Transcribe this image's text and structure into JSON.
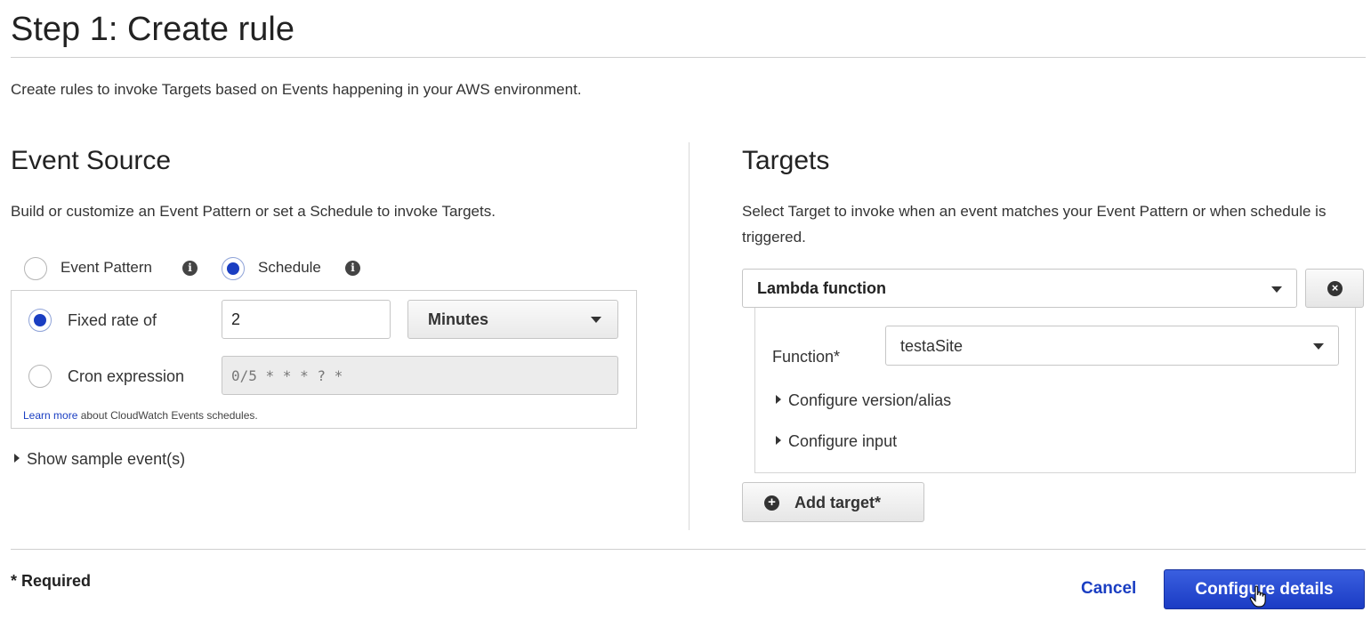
{
  "header": {
    "title": "Step 1: Create rule",
    "intro": "Create rules to invoke Targets based on Events happening in your AWS environment."
  },
  "event_source": {
    "title": "Event Source",
    "description": "Build or customize an Event Pattern or set a Schedule to invoke Targets.",
    "options": [
      {
        "label": "Event Pattern",
        "selected": false
      },
      {
        "label": "Schedule",
        "selected": true
      }
    ],
    "schedule": {
      "fixed_rate_label": "Fixed rate of",
      "fixed_rate_selected": true,
      "fixed_rate_value": "2",
      "unit": "Minutes",
      "cron_label": "Cron expression",
      "cron_selected": false,
      "cron_placeholder": "0/5 * * * ? *",
      "learn_more_link": "Learn more",
      "learn_more_text": " about CloudWatch Events schedules."
    },
    "show_sample": "Show sample event(s)"
  },
  "targets": {
    "title": "Targets",
    "description": "Select Target to invoke when an event matches your Event Pattern or when schedule is triggered.",
    "target_type": "Lambda function",
    "function_label": "Function*",
    "function_value": "testaSite",
    "configure_version": "Configure version/alias",
    "configure_input": "Configure input",
    "add_target": "Add target*"
  },
  "footer": {
    "required_note": "* Required",
    "cancel": "Cancel",
    "configure_details": "Configure details"
  },
  "colors": {
    "accent": "#1a3ec2",
    "primary_button": "#2446cf"
  }
}
